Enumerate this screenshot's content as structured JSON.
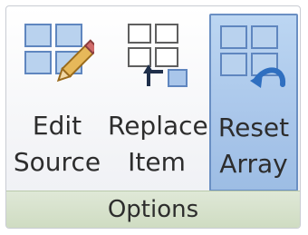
{
  "ribbon_group": {
    "name": "Options",
    "buttons": [
      {
        "line1": "Edit",
        "line2": "Source",
        "icon": "edit-source-icon"
      },
      {
        "line1": "Replace",
        "line2": "Item",
        "icon": "replace-item-icon"
      },
      {
        "line1": "Reset",
        "line2": "Array",
        "icon": "reset-array-icon",
        "state": "active"
      }
    ]
  },
  "colors": {
    "icon_fill": "#b9d2ee",
    "icon_stroke": "#5f86bf",
    "active_bg": "#a9c6ea",
    "group_bar": "#cfdcc2"
  }
}
